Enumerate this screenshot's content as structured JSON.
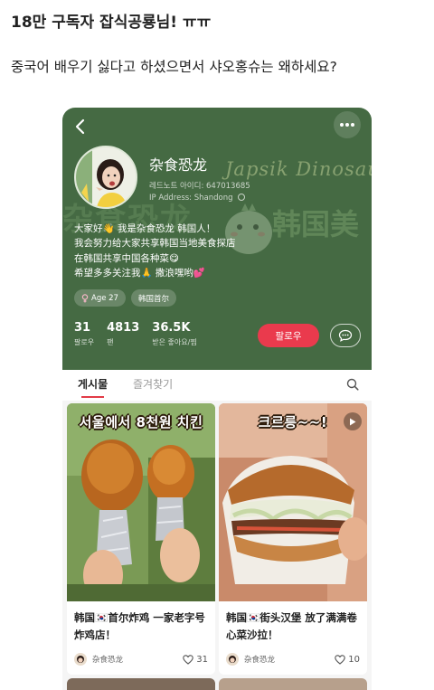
{
  "post": {
    "title": "18만 구독자 잡식공룡님! ㅠㅠ",
    "body": "중국어 배우기 싫다고 하셨으면서 샤오홍슈는 왜하세요?"
  },
  "profile": {
    "nickname": "杂食恐龙",
    "account_id": "레드노트 아이디: 647013685",
    "ip_address": "IP Address: Shandong",
    "watermark_en": "Japsik Dinosaur",
    "watermark_cn": "杂食恐龙",
    "watermark_cn2": "韩国美",
    "bio_lines": [
      "大家好👋 我是杂食恐龙 韩国人！",
      "我会努力给大家共享韩国当地美食探店",
      "在韩国共享中国各种菜😋",
      "希望多多关注我🙏 撒浪嘿哟💕"
    ],
    "tags": {
      "age": "Age 27",
      "location": "韩国首尔"
    },
    "stats": [
      {
        "value": "31",
        "label": "팔로우"
      },
      {
        "value": "4813",
        "label": "팬"
      },
      {
        "value": "36.5K",
        "label": "받은 좋아요/찜"
      }
    ],
    "follow_label": "팔로우"
  },
  "tabs": {
    "posts": "게시물",
    "favorites": "즐겨찾기"
  },
  "cards": [
    {
      "overlay": "서울에서 8천원 치킨",
      "title": "韩国🇰🇷首尔炸鸡 一家老字号炸鸡店！",
      "author": "杂食恐龙",
      "likes": "31"
    },
    {
      "overlay": "크르릉~~!",
      "title": "韩国🇰🇷街头汉堡 放了满满卷心菜沙拉！",
      "author": "杂食恐龙",
      "likes": "10"
    }
  ],
  "colors": {
    "profile_bg": "#456a43",
    "follow_btn": "#ea3a4d",
    "tab_underline": "#e23b47"
  },
  "icons": [
    "back-arrow-icon",
    "more-icon",
    "female-icon",
    "chat-icon",
    "search-icon",
    "play-icon",
    "heart-icon"
  ]
}
